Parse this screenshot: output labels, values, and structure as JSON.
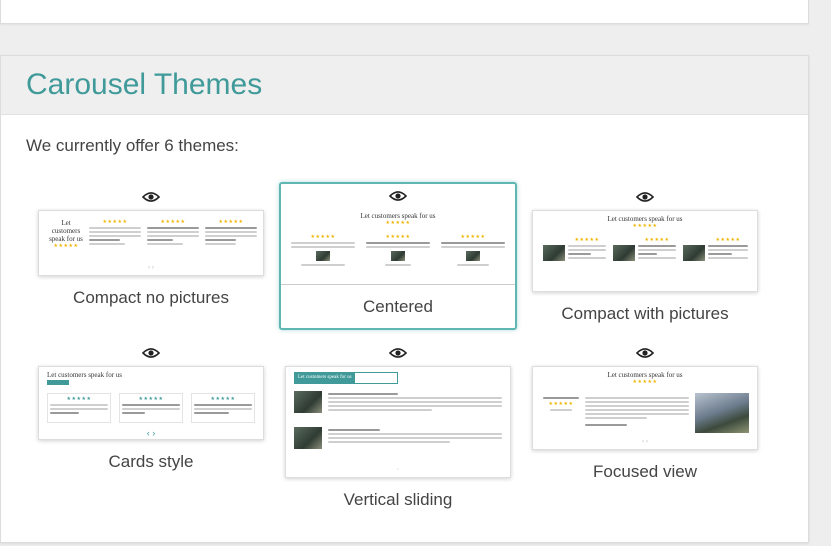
{
  "section": {
    "title": "Carousel Themes",
    "intro": "We currently offer 6 themes:"
  },
  "colors": {
    "accent": "#3f9a99",
    "selected_border": "#5fb6b3",
    "star": "#f0b400"
  },
  "preview_icon": "eye-icon",
  "themes": [
    {
      "label": "Compact no pictures",
      "selected": false
    },
    {
      "label": "Centered",
      "selected": true
    },
    {
      "label": "Compact with pictures",
      "selected": false
    },
    {
      "label": "Cards style",
      "selected": false
    },
    {
      "label": "Vertical sliding",
      "selected": false
    },
    {
      "label": "Focused view",
      "selected": false
    }
  ],
  "thumb_text": {
    "heading": "Let customers speak for us",
    "stars": "★★★★★"
  }
}
